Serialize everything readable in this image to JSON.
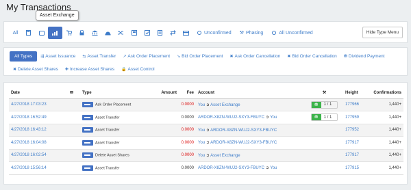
{
  "page_title": "My Transactions",
  "tooltip": "Asset Exchange",
  "filter_bar": {
    "all_label": "All",
    "icons": [
      "calculator-icon",
      "square-icon",
      "asset-exchange-icon",
      "cart-icon",
      "lock-icon",
      "bank-icon",
      "vault-icon",
      "shuffle-icon",
      "box-icon",
      "checklist-icon",
      "file-icon",
      "arrows-icon",
      "card-icon"
    ],
    "unconfirmed_label": "Unconfirmed",
    "phasing_label": "Phasing",
    "all_unconfirmed_label": "All Unconfirmed",
    "hide_menu_label": "Hide Type Menu"
  },
  "type_filters": [
    {
      "label": "All Types",
      "glyph": ""
    },
    {
      "label": "Asset Issuance",
      "glyph": "⇶"
    },
    {
      "label": "Asset Transfer",
      "glyph": "⇆"
    },
    {
      "label": "Ask Order Placement",
      "glyph": "↗"
    },
    {
      "label": "Bid Order Placement",
      "glyph": "↘"
    },
    {
      "label": "Ask Order Cancellation",
      "glyph": "✖"
    },
    {
      "label": "Bid Order Cancellation",
      "glyph": "✖"
    },
    {
      "label": "Dividend Payment",
      "glyph": "⛃"
    },
    {
      "label": "Delete Asset Shares",
      "glyph": "✖"
    },
    {
      "label": "Increase Asset Shares",
      "glyph": "✚"
    },
    {
      "label": "Asset Control",
      "glyph": "🔒"
    }
  ],
  "table": {
    "headers": {
      "date": "Date",
      "type": "Type",
      "amount": "Amount",
      "fee": "Fee",
      "account": "Account",
      "height": "Height",
      "confirmations": "Confirmations"
    },
    "rows": [
      {
        "date": "4/27/2018 17:03:23",
        "type": "Ask Order Placement",
        "amount": "",
        "fee": "0.0000",
        "fee_color": "#dd1111",
        "from": "You",
        "to": "Asset Exchange",
        "phase": "1 / 1",
        "height": "177966",
        "conf": "1,440+"
      },
      {
        "date": "4/27/2018 16:52:49",
        "type": "Asset Transfer",
        "amount": "",
        "fee": "0.0000",
        "fee_color": "#333333",
        "from": "ARDOR-X8ZN-WUJ2-SXY3-FBUYC",
        "to": "You",
        "phase": "1 / 1",
        "height": "177959",
        "conf": "1,440+"
      },
      {
        "date": "4/27/2018 16:43:12",
        "type": "Asset Transfer",
        "amount": "",
        "fee": "0.0000",
        "fee_color": "#dd1111",
        "from": "You",
        "to": "ARDOR-X8ZN-WUJ2-SXY3-FBUYC",
        "phase": "",
        "height": "177952",
        "conf": "1,440+"
      },
      {
        "date": "4/27/2018 16:04:08",
        "type": "Asset Transfer",
        "amount": "",
        "fee": "0.0000",
        "fee_color": "#dd1111",
        "from": "You",
        "to": "ARDOR-X8ZN-WUJ2-SXY3-FBUYC",
        "phase": "",
        "height": "177917",
        "conf": "1,440+"
      },
      {
        "date": "4/27/2018 16:02:54",
        "type": "Delete Asset Shares",
        "amount": "",
        "fee": "0.0000",
        "fee_color": "#dd1111",
        "from": "You",
        "to": "Asset Exchange",
        "phase": "",
        "height": "177917",
        "conf": "1,440+"
      },
      {
        "date": "4/27/2018 15:56:14",
        "type": "Asset Transfer",
        "amount": "",
        "fee": "0.0000",
        "fee_color": "#333333",
        "from": "ARDOR-X8ZN-WUJ2-SXY3-FBUYC",
        "to": "You",
        "phase": "",
        "height": "177915",
        "conf": "1,440+"
      }
    ]
  }
}
